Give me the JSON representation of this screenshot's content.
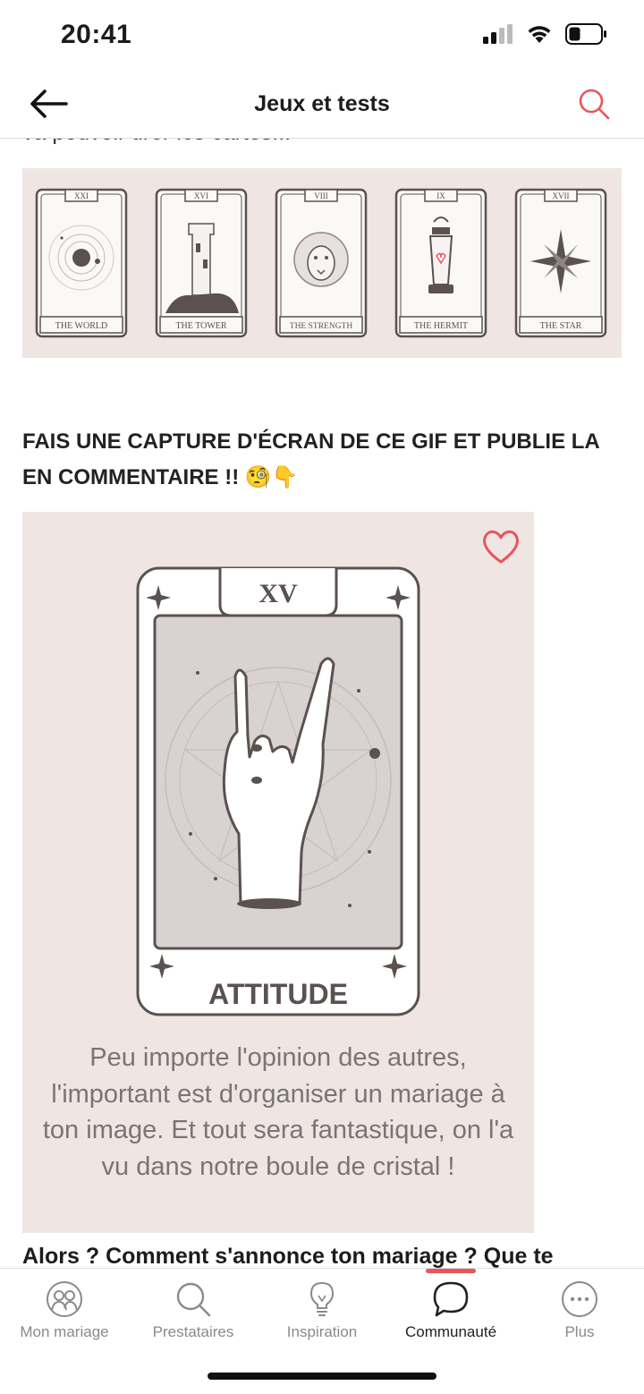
{
  "status": {
    "time": "20:41"
  },
  "nav": {
    "title": "Jeux et tests"
  },
  "content": {
    "cut_text": "va pouvoir tirer les cartes...",
    "cards": [
      {
        "numeral": "XXI",
        "label": "THE WORLD"
      },
      {
        "numeral": "XVI",
        "label": "THE TOWER"
      },
      {
        "numeral": "VIII",
        "label": "THE STRENGTH"
      },
      {
        "numeral": "IX",
        "label": "THE HERMIT"
      },
      {
        "numeral": "XVII",
        "label": "THE STAR"
      }
    ],
    "heading": "FAIS UNE CAPTURE D'ÉCRAN DE CE GIF ET PUBLIE LA EN COMMENTAIRE !! 🧐👇",
    "gif": {
      "numeral": "XV",
      "card_title": "ATTITUDE",
      "caption": "Peu importe l'opinion des autres, l'important est d'organiser un mariage à ton image. Et tout sera fantastique, on l'a vu dans notre boule de cristal !"
    },
    "next_text": "Alors ? Comment s'annonce ton mariage ? Que te"
  },
  "tabs": [
    {
      "label": "Mon mariage",
      "icon": "couple-icon",
      "active": false
    },
    {
      "label": "Prestataires",
      "icon": "search-icon",
      "active": false
    },
    {
      "label": "Inspiration",
      "icon": "lightbulb-icon",
      "active": false
    },
    {
      "label": "Communauté",
      "icon": "chat-bubble-icon",
      "active": true
    },
    {
      "label": "Plus",
      "icon": "more-icon",
      "active": false
    }
  ],
  "colors": {
    "accent": "#e8555b",
    "card_bg": "#efe6e4",
    "ink": "#5b5150"
  }
}
